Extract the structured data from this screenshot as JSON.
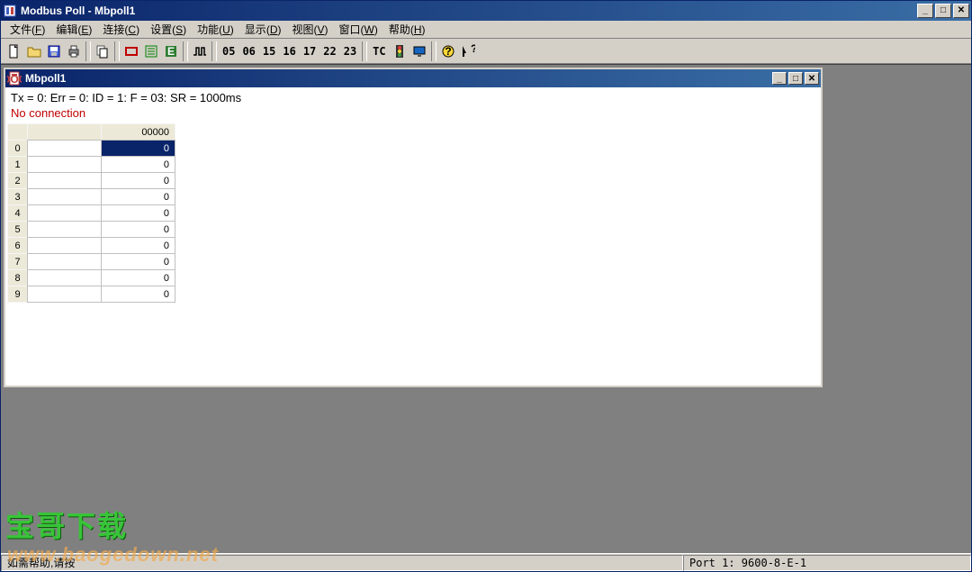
{
  "app": {
    "title": "Modbus Poll - Mbpoll1"
  },
  "menus": [
    {
      "label": "文件",
      "accel": "F"
    },
    {
      "label": "编辑",
      "accel": "E"
    },
    {
      "label": "连接",
      "accel": "C"
    },
    {
      "label": "设置",
      "accel": "S"
    },
    {
      "label": "功能",
      "accel": "U"
    },
    {
      "label": "显示",
      "accel": "D"
    },
    {
      "label": "视图",
      "accel": "V"
    },
    {
      "label": "窗口",
      "accel": "W"
    },
    {
      "label": "帮助",
      "accel": "H"
    }
  ],
  "toolbar_codes": [
    "05",
    "06",
    "15",
    "16",
    "17",
    "22",
    "23"
  ],
  "toolbar_tc": "TC",
  "child": {
    "title": "Mbpoll1",
    "status": "Tx = 0: Err = 0: ID = 1: F = 03: SR = 1000ms",
    "no_connection": "No connection",
    "col_header_b": "00000",
    "rows": [
      {
        "idx": "0",
        "a": "",
        "b": "0",
        "selected": true
      },
      {
        "idx": "1",
        "a": "",
        "b": "0"
      },
      {
        "idx": "2",
        "a": "",
        "b": "0"
      },
      {
        "idx": "3",
        "a": "",
        "b": "0"
      },
      {
        "idx": "4",
        "a": "",
        "b": "0"
      },
      {
        "idx": "5",
        "a": "",
        "b": "0"
      },
      {
        "idx": "6",
        "a": "",
        "b": "0"
      },
      {
        "idx": "7",
        "a": "",
        "b": "0"
      },
      {
        "idx": "8",
        "a": "",
        "b": "0"
      },
      {
        "idx": "9",
        "a": "",
        "b": "0"
      }
    ]
  },
  "statusbar": {
    "hint": "如需帮助,请按",
    "port": "Port 1: 9600-8-E-1"
  },
  "watermark": {
    "line1": "宝哥下载",
    "line2": "www.baogedown.net"
  }
}
